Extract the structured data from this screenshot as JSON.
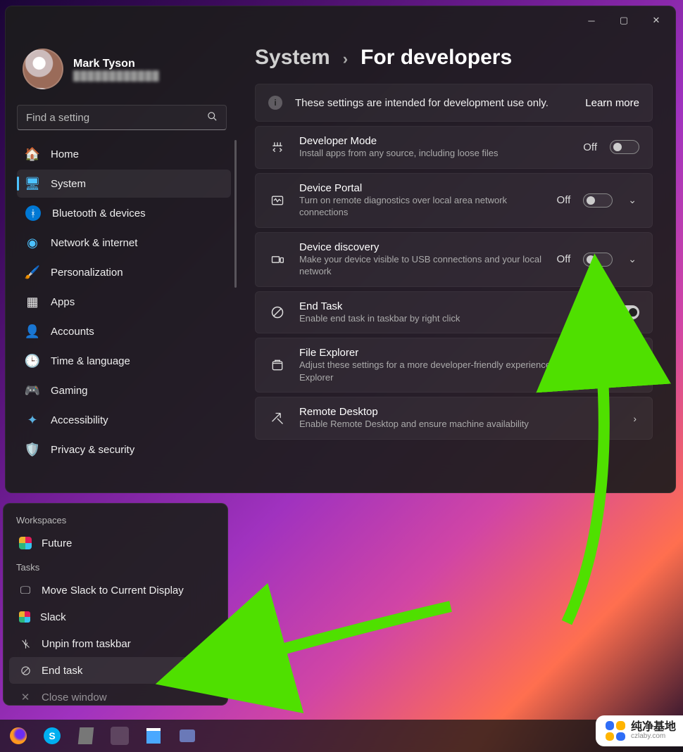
{
  "user": {
    "name": "Mark Tyson",
    "email_masked": "████████████"
  },
  "search": {
    "placeholder": "Find a setting"
  },
  "sidebar": {
    "items": [
      {
        "icon": "🏠",
        "label": "Home"
      },
      {
        "icon": "🖥️",
        "label": "System"
      },
      {
        "icon": "ᚼ",
        "label": "Bluetooth & devices"
      },
      {
        "icon": "📶",
        "label": "Network & internet"
      },
      {
        "icon": "🖌️",
        "label": "Personalization"
      },
      {
        "icon": "▦",
        "label": "Apps"
      },
      {
        "icon": "👤",
        "label": "Accounts"
      },
      {
        "icon": "🕒",
        "label": "Time & language"
      },
      {
        "icon": "🎮",
        "label": "Gaming"
      },
      {
        "icon": "✦",
        "label": "Accessibility"
      },
      {
        "icon": "🛡️",
        "label": "Privacy & security"
      }
    ]
  },
  "breadcrumb": {
    "parent": "System",
    "current": "For developers"
  },
  "banner": {
    "text": "These settings are intended for development use only.",
    "learn_more": "Learn more"
  },
  "rows": [
    {
      "title": "Developer Mode",
      "sub": "Install apps from any source, including loose files",
      "state": "Off",
      "on": false,
      "expand": false
    },
    {
      "title": "Device Portal",
      "sub": "Turn on remote diagnostics over local area network connections",
      "state": "Off",
      "on": false,
      "expand": true
    },
    {
      "title": "Device discovery",
      "sub": "Make your device visible to USB connections and your local network",
      "state": "Off",
      "on": false,
      "expand": true
    },
    {
      "title": "End Task",
      "sub": "Enable end task in taskbar by right click",
      "state": "On",
      "on": true,
      "expand": false
    },
    {
      "title": "File Explorer",
      "sub": "Adjust these settings for a more developer-friendly experience using File Explorer",
      "state": "",
      "on": null,
      "expand": true
    },
    {
      "title": "Remote Desktop",
      "sub": "Enable Remote Desktop and ensure machine availability",
      "state": "",
      "on": null,
      "nav": true
    }
  ],
  "context_menu": {
    "workspaces_header": "Workspaces",
    "workspace": "Future",
    "tasks_header": "Tasks",
    "items": [
      {
        "icon": "🖵",
        "label": "Move Slack to Current Display"
      },
      {
        "icon": "❖",
        "label": "Slack"
      },
      {
        "icon": "⚲",
        "label": "Unpin from taskbar"
      },
      {
        "icon": "⊘",
        "label": "End task"
      },
      {
        "icon": "✕",
        "label": "Close window"
      }
    ]
  },
  "watermark": {
    "cn": "纯净基地",
    "en": "czlaby.com"
  }
}
